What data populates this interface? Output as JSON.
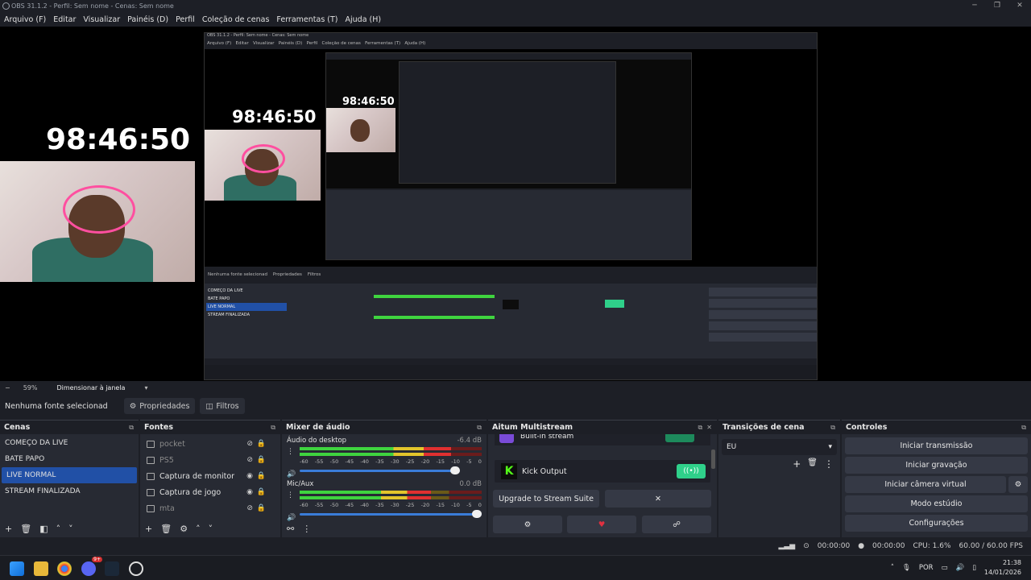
{
  "window": {
    "title": "OBS 31.1.2 - Perfil: Sem nome - Cenas: Sem nome",
    "controls": [
      "─",
      "❐",
      "✕"
    ]
  },
  "menu": [
    "Arquivo (F)",
    "Editar",
    "Visualizar",
    "Painéis (D)",
    "Perfil",
    "Coleção de cenas",
    "Ferramentas (T)",
    "Ajuda (H)"
  ],
  "preview": {
    "timer": "98:46:50"
  },
  "dockbar": {
    "zoom": "59%",
    "mode": "Dimensionar à janela"
  },
  "sourcebar": {
    "status": "Nenhuma fonte selecionad",
    "properties": "Propriedades",
    "filters": "Filtros"
  },
  "scenes": {
    "title": "Cenas",
    "items": [
      "COMEÇO DA LIVE",
      "BATE PAPO",
      "LIVE NORMAL",
      "STREAM FINALIZADA"
    ],
    "selected": 2
  },
  "sources": {
    "title": "Fontes",
    "items": [
      {
        "name": "pocket",
        "visible": false,
        "locked": true
      },
      {
        "name": "PS5",
        "visible": false,
        "locked": true
      },
      {
        "name": "Captura de monitor",
        "visible": true,
        "locked": true
      },
      {
        "name": "Captura de jogo",
        "visible": true,
        "locked": true
      },
      {
        "name": "mta",
        "visible": false,
        "locked": true
      }
    ]
  },
  "mixer": {
    "title": "Mixer de áudio",
    "ticks": [
      "-60",
      "-55",
      "-50",
      "-45",
      "-40",
      "-35",
      "-30",
      "-25",
      "-20",
      "-15",
      "-10",
      "-5",
      "0"
    ],
    "channels": [
      {
        "name": "Áudio do desktop",
        "db": "-6.4 dB",
        "level": 0.83,
        "volume": 0.88
      },
      {
        "name": "Mic/Aux",
        "db": "0.0 dB",
        "level": 0.72,
        "volume": 1.0
      }
    ]
  },
  "multistream": {
    "title": "Aitum Multistream",
    "builtin_label": "Built-in stream",
    "kick_label": "Kick Output",
    "upgrade": "Upgrade to Stream Suite",
    "close": "✕"
  },
  "transitions": {
    "title": "Transições de cena",
    "selected": "EU"
  },
  "controls": {
    "title": "Controles",
    "buttons": [
      "Iniciar transmissão",
      "Iniciar gravação",
      "Iniciar câmera virtual",
      "Modo estúdio",
      "Configurações"
    ]
  },
  "status": {
    "rec_time": "00:00:00",
    "stream_time": "00:00:00",
    "cpu": "CPU: 1.6%",
    "fps": "60.00 / 60.00 FPS"
  },
  "taskbar": {
    "lang": "POR",
    "time": "21:38",
    "date": "14/01/2026",
    "badge": "9+"
  }
}
